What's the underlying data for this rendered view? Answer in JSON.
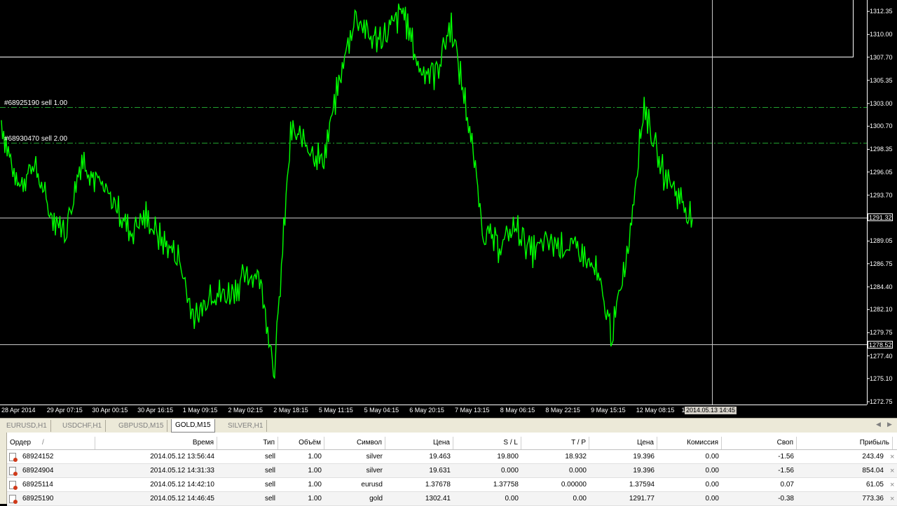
{
  "orders": [
    {
      "label": "#68925190 sell 1.00"
    },
    {
      "label": "#68930470 sell 2.00"
    }
  ],
  "price_axis": {
    "ticks": [
      "1312.35",
      "1310.00",
      "1307.70",
      "1305.35",
      "1303.00",
      "1300.70",
      "1298.35",
      "1296.05",
      "1293.70",
      "1291.35",
      "1289.05",
      "1286.75",
      "1284.40",
      "1282.10",
      "1279.75",
      "1277.40",
      "1275.10",
      "1272.75"
    ],
    "current_price": "1291.32",
    "crosshair_price": "1278.52"
  },
  "time_axis": {
    "labels": [
      "28 Apr 2014",
      "29 Apr 07:15",
      "30 Apr 00:15",
      "30 Apr 16:15",
      "1 May 09:15",
      "2 May 02:15",
      "2 May 18:15",
      "5 May 11:15",
      "5 May 04:15",
      "6 May 20:15",
      "7 May 13:15",
      "8 May 06:15",
      "8 May 22:15",
      "9 May 15:15",
      "12 May 08:15",
      "13"
    ],
    "crosshair_time": "2014.05.13 14:45"
  },
  "symbol_tabs": [
    "EURUSD,H1",
    "USDCHF,H1",
    "GBPUSD,M15",
    "GOLD,M15",
    "SILVER,H1"
  ],
  "active_tab": "GOLD,M15",
  "table": {
    "headers": [
      "Ордер",
      "/",
      "Время",
      "Тип",
      "Объём",
      "Символ",
      "Цена",
      "S / L",
      "T / P",
      "Цена",
      "Комиссия",
      "Своп",
      "Прибыль"
    ],
    "rows": [
      [
        "68924152",
        "2014.05.12 13:56:44",
        "sell",
        "1.00",
        "silver",
        "19.463",
        "19.800",
        "18.932",
        "19.396",
        "0.00",
        "-1.56",
        "243.49"
      ],
      [
        "68924904",
        "2014.05.12 14:31:33",
        "sell",
        "1.00",
        "silver",
        "19.631",
        "0.000",
        "0.000",
        "19.396",
        "0.00",
        "-1.56",
        "854.04"
      ],
      [
        "68925114",
        "2014.05.12 14:42:10",
        "sell",
        "1.00",
        "eurusd",
        "1.37678",
        "1.37758",
        "0.00000",
        "1.37594",
        "0.00",
        "0.07",
        "61.05"
      ],
      [
        "68925190",
        "2014.05.12 14:46:45",
        "sell",
        "1.00",
        "gold",
        "1302.41",
        "0.00",
        "0.00",
        "1291.77",
        "0.00",
        "-0.38",
        "773.36"
      ]
    ]
  },
  "chart_data": {
    "type": "line",
    "symbol": "GOLD,M15",
    "ylim": [
      1272.75,
      1313.5
    ],
    "series": [
      {
        "x": [
          "28 Apr 2014",
          "28 Apr",
          "28 Apr",
          "29 Apr",
          "29 Apr 07:15",
          "29 Apr",
          "29 Apr",
          "30 Apr 00:15",
          "30 Apr",
          "30 Apr",
          "30 Apr 16:15",
          "1 May",
          "1 May 09:15",
          "1 May",
          "1 May",
          "1 May",
          "2 May",
          "2 May 02:15",
          "2 May",
          "2 May",
          "2 May 18:15",
          "5 May",
          "5 May 11:15",
          "5 May",
          "5 May 04:15",
          "5 May",
          "6 May 20:15",
          "6 May",
          "6 May",
          "7 May 13:15",
          "7 May",
          "8 May",
          "8 May 06:15",
          "8 May",
          "8 May 22:15",
          "8 May",
          "9 May",
          "9 May 15:15",
          "9 May",
          "12 May 08:15",
          "12 May",
          "12 May",
          "13 May",
          "13 May"
        ],
        "values": [
          1301.0,
          1294.5,
          1297.0,
          1292.0,
          1290.0,
          1297.5,
          1295.0,
          1293.0,
          1290.0,
          1291.5,
          1289.0,
          1287.5,
          1281.0,
          1284.0,
          1283.5,
          1285.0,
          1286.0,
          1276.0,
          1300.0,
          1299.0,
          1297.0,
          1305.0,
          1312.0,
          1309.5,
          1310.0,
          1312.5,
          1306.5,
          1306.0,
          1311.0,
          1302.0,
          1290.0,
          1288.5,
          1290.5,
          1288.0,
          1289.0,
          1288.5,
          1288.0,
          1286.0,
          1279.5,
          1288.5,
          1303.0,
          1296.5,
          1294.0,
          1291.3
        ]
      }
    ]
  }
}
